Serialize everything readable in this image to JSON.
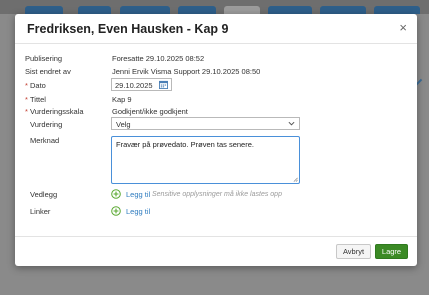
{
  "modal": {
    "title": "Fredriksen, Even Hausken - Kap 9",
    "close_glyph": "×"
  },
  "fields": {
    "publisering": {
      "label": "Publisering",
      "value": "Foresatte   29.10.2025 08:52"
    },
    "sist_endret": {
      "label": "Sist endret av",
      "value": "Jenni Ervik Visma Support 29.10.2025 08:50"
    },
    "dato": {
      "label": "Dato",
      "value": "29.10.2025",
      "required": "*"
    },
    "tittel": {
      "label": "Tittel",
      "value": "Kap 9",
      "required": "*"
    },
    "vurderingsskala": {
      "label": "Vurderingsskala",
      "value": "Godkjent/ikke godkjent",
      "required": "*"
    },
    "vurdering": {
      "label": "Vurdering",
      "value": "Velg"
    },
    "merknad": {
      "label": "Merknad",
      "value": "Fravær på prøvedato. Prøven tas senere."
    },
    "vedlegg": {
      "label": "Vedlegg",
      "link": "Legg til",
      "hint": "Sensitive opplysninger må ikke lastes opp"
    },
    "linker": {
      "label": "Linker",
      "link": "Legg til"
    }
  },
  "footer": {
    "cancel_label": "Avbryt",
    "save_label": "Lagre"
  },
  "colors": {
    "accent_link": "#2e7bbf",
    "save_green": "#3b8a25",
    "focus_blue": "#4a90d9",
    "add_icon_green": "#5aa832"
  },
  "icons": {
    "close": "close-icon",
    "calendar": "calendar-icon",
    "chevron": "chevron-down-icon",
    "add": "add-circle-icon"
  }
}
